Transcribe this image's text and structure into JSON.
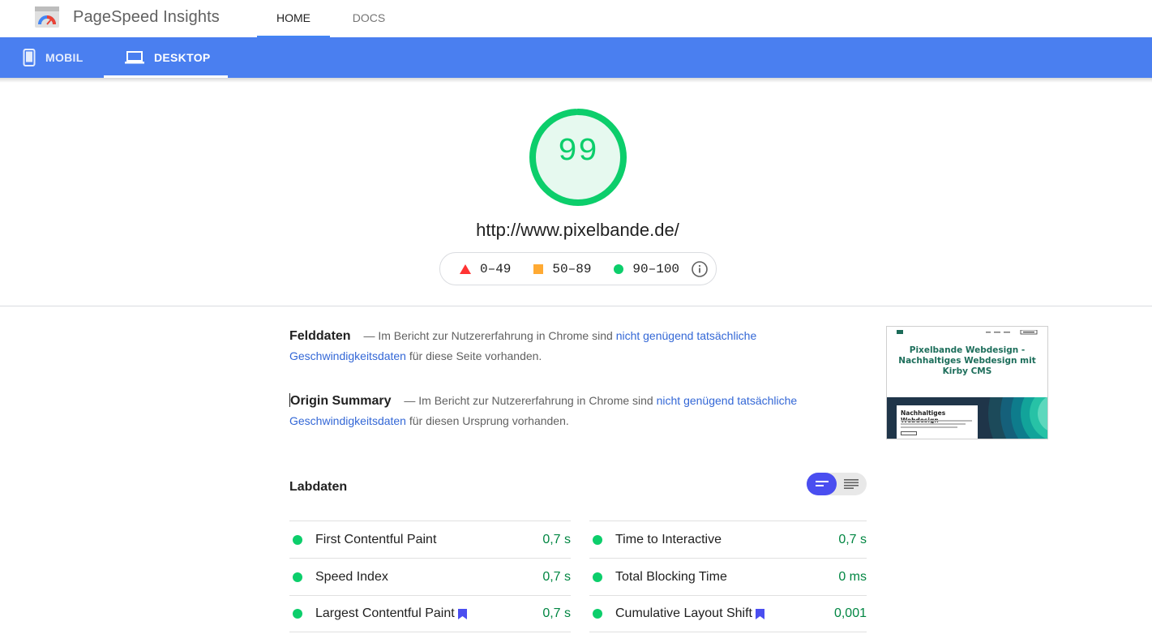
{
  "header": {
    "app_title": "PageSpeed Insights",
    "tabs": [
      {
        "label": "HOME",
        "active": true
      },
      {
        "label": "DOCS",
        "active": false
      }
    ]
  },
  "device_tabs": [
    {
      "label": "MOBIL",
      "icon": "smartphone-icon",
      "active": false
    },
    {
      "label": "DESKTOP",
      "icon": "laptop-icon",
      "active": true
    }
  ],
  "score": {
    "value": "99",
    "fraction": 0.99,
    "color": "#0cce6b"
  },
  "url": "http://www.pixelbande.de/",
  "legend": [
    {
      "range": "0–49",
      "shape": "triangle",
      "color": "#ff3333"
    },
    {
      "range": "50–89",
      "shape": "square",
      "color": "#ffaa33"
    },
    {
      "range": "90–100",
      "shape": "circle",
      "color": "#0cce6b"
    }
  ],
  "field_data": {
    "title": "Felddaten",
    "dash": "—",
    "text_before": "Im Bericht zur Nutzererfahrung in Chrome sind",
    "link_text": "nicht genügend tatsächliche Geschwindigkeitsdaten",
    "text_after": "für diese Seite vorhanden."
  },
  "origin_summary": {
    "title": "Origin Summary",
    "dash": "—",
    "text_before": "Im Bericht zur Nutzererfahrung in Chrome sind",
    "link_text": "nicht genügend tatsächliche Geschwindigkeitsdaten",
    "text_after": "für diesen Ursprung vorhanden."
  },
  "thumbnail": {
    "title": "Pixelbande Webdesign - Nachhaltiges Webdesign mit Kirby CMS",
    "card_title": "Nachhaltiges Webdesign"
  },
  "lab_data": {
    "title": "Labdaten",
    "metrics_left": [
      {
        "name": "First Contentful Paint",
        "value": "0,7 s",
        "bookmark": false
      },
      {
        "name": "Speed Index",
        "value": "0,7 s",
        "bookmark": false
      },
      {
        "name": "Largest Contentful Paint",
        "value": "0,7 s",
        "bookmark": true
      }
    ],
    "metrics_right": [
      {
        "name": "Time to Interactive",
        "value": "0,7 s",
        "bookmark": false
      },
      {
        "name": "Total Blocking Time",
        "value": "0 ms",
        "bookmark": false
      },
      {
        "name": "Cumulative Layout Shift",
        "value": "0,001",
        "bookmark": true
      }
    ]
  },
  "colors": {
    "device_bar": "#4a7ff0",
    "link": "#3367d6",
    "pass_green": "#0cce6b",
    "value_green": "#018642",
    "bookmark": "#4a4ef0"
  }
}
